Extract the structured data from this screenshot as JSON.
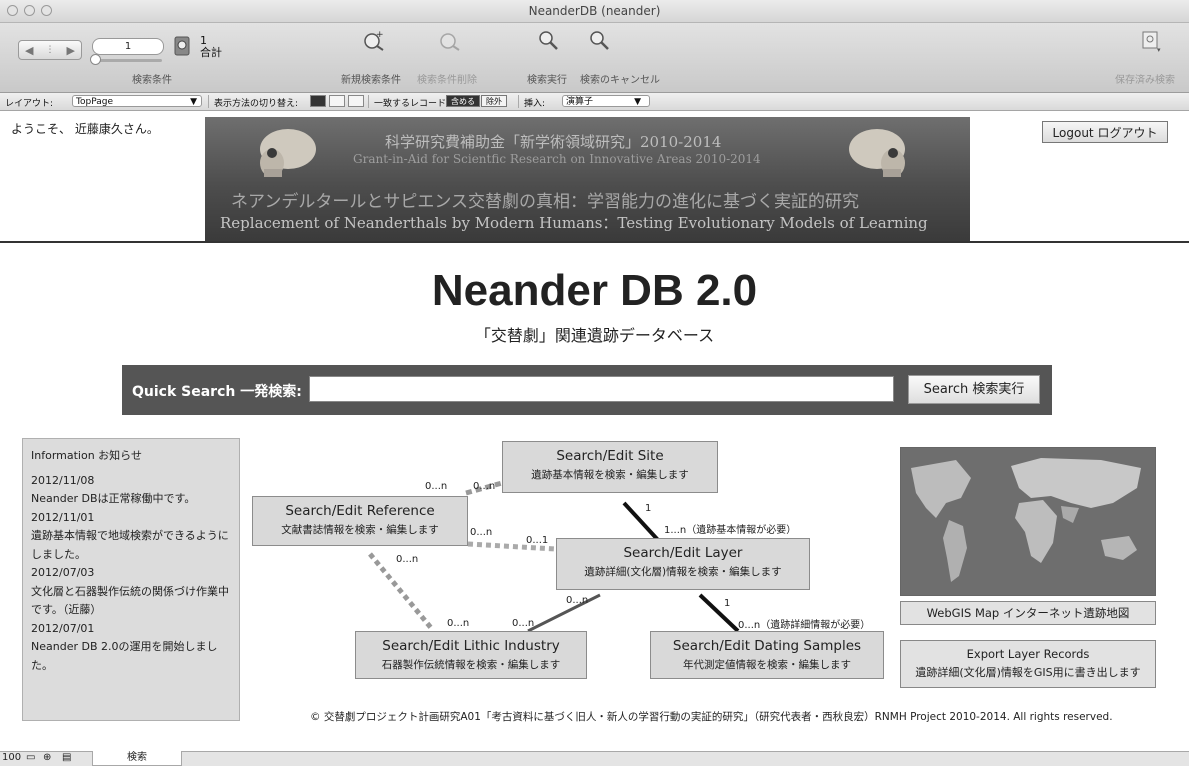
{
  "window": {
    "title": "NeanderDB (neander)"
  },
  "toolbar": {
    "record_value": "1",
    "record_count": "1",
    "record_total_label": "合計",
    "find_criteria_label": "検索条件",
    "new_request_label": "新規検索条件",
    "delete_request_label": "検索条件削除",
    "perform_find_label": "検索実行",
    "cancel_find_label": "検索のキャンセル",
    "saved_finds_label": "保存済み検索"
  },
  "layoutbar": {
    "layout_label": "レイアウト:",
    "layout_value": "TopPage",
    "view_as_label": "表示方法の切り替え:",
    "matching_label": "一致するレコード:",
    "include_label": "含める",
    "omit_label": "除外",
    "insert_label": "挿入:",
    "insert_value": "演算子"
  },
  "header": {
    "welcome": "ようこそ、 近藤康久さん。",
    "logout_label": "Logout ログアウト",
    "banner_line1": "科学研究費補助金「新学術領域研究」2010-2014",
    "banner_line2": "Grant-in-Aid for Scientfic Research on Innovative Areas 2010-2014",
    "banner_line3": "ネアンデルタールとサピエンス交替劇の真相：学習能力の進化に基づく実証的研究",
    "banner_line4": "Replacement of Neanderthals by Modern Humans：Testing Evolutionary Models of Learning"
  },
  "main": {
    "title": "Neander DB 2.0",
    "subtitle": "「交替劇」関連遺跡データベース"
  },
  "quick_search": {
    "label": "Quick Search 一発検索:",
    "value": "",
    "button_label": "Search 検索実行"
  },
  "info": {
    "heading": "Information お知らせ",
    "items": [
      {
        "date": "2012/11/08",
        "text": "Neander DBは正常稼働中です。"
      },
      {
        "date": "2012/11/01",
        "text": "遺跡基本情報で地域検索ができるようにしました。"
      },
      {
        "date": "2012/07/03",
        "text": "文化層と石器製作伝統の関係づけ作業中です。（近藤）"
      },
      {
        "date": "2012/07/01",
        "text": "Neander DB 2.0の運用を開始しました。"
      }
    ]
  },
  "diagram": {
    "site": {
      "title": "Search/Edit Site",
      "sub": "遺跡基本情報を検索・編集します"
    },
    "reference": {
      "title": "Search/Edit Reference",
      "sub": "文献書誌情報を検索・編集します"
    },
    "layer": {
      "title": "Search/Edit Layer",
      "sub": "遺跡詳細(文化層)情報を検索・編集します"
    },
    "lithic": {
      "title": "Search/Edit Lithic Industry",
      "sub": "石器製作伝統情報を検索・編集します"
    },
    "dating": {
      "title": "Search/Edit Dating Samples",
      "sub": "年代測定値情報を検索・編集します"
    },
    "cardinalities": {
      "ref_site_a": "0...n",
      "ref_site_b": "0...n",
      "site_layer_a": "1",
      "site_layer_b": "1...n（遺跡基本情報が必要）",
      "ref_layer_a": "0...n",
      "ref_layer_b": "0...1",
      "ref_lithic_a": "0...n",
      "ref_lithic_b": "0...n",
      "layer_lithic_a": "0...n",
      "layer_lithic_b": "0...n",
      "layer_dating_a": "1",
      "layer_dating_b": "0...n（遺跡詳細情報が必要）"
    }
  },
  "side": {
    "webgis_label": "WebGIS Map インターネット遺跡地図",
    "export_title": "Export Layer Records",
    "export_sub": "遺跡詳細(文化層)情報をGIS用に書き出します"
  },
  "footer": {
    "text": "© 交替劇プロジェクト計画研究A01「考古資料に基づく旧人・新人の学習行動の実証的研究」（研究代表者・西秋良宏）RNMH Project 2010-2014. All rights reserved."
  },
  "statusbar": {
    "zoom": "100",
    "mode": "検索"
  }
}
